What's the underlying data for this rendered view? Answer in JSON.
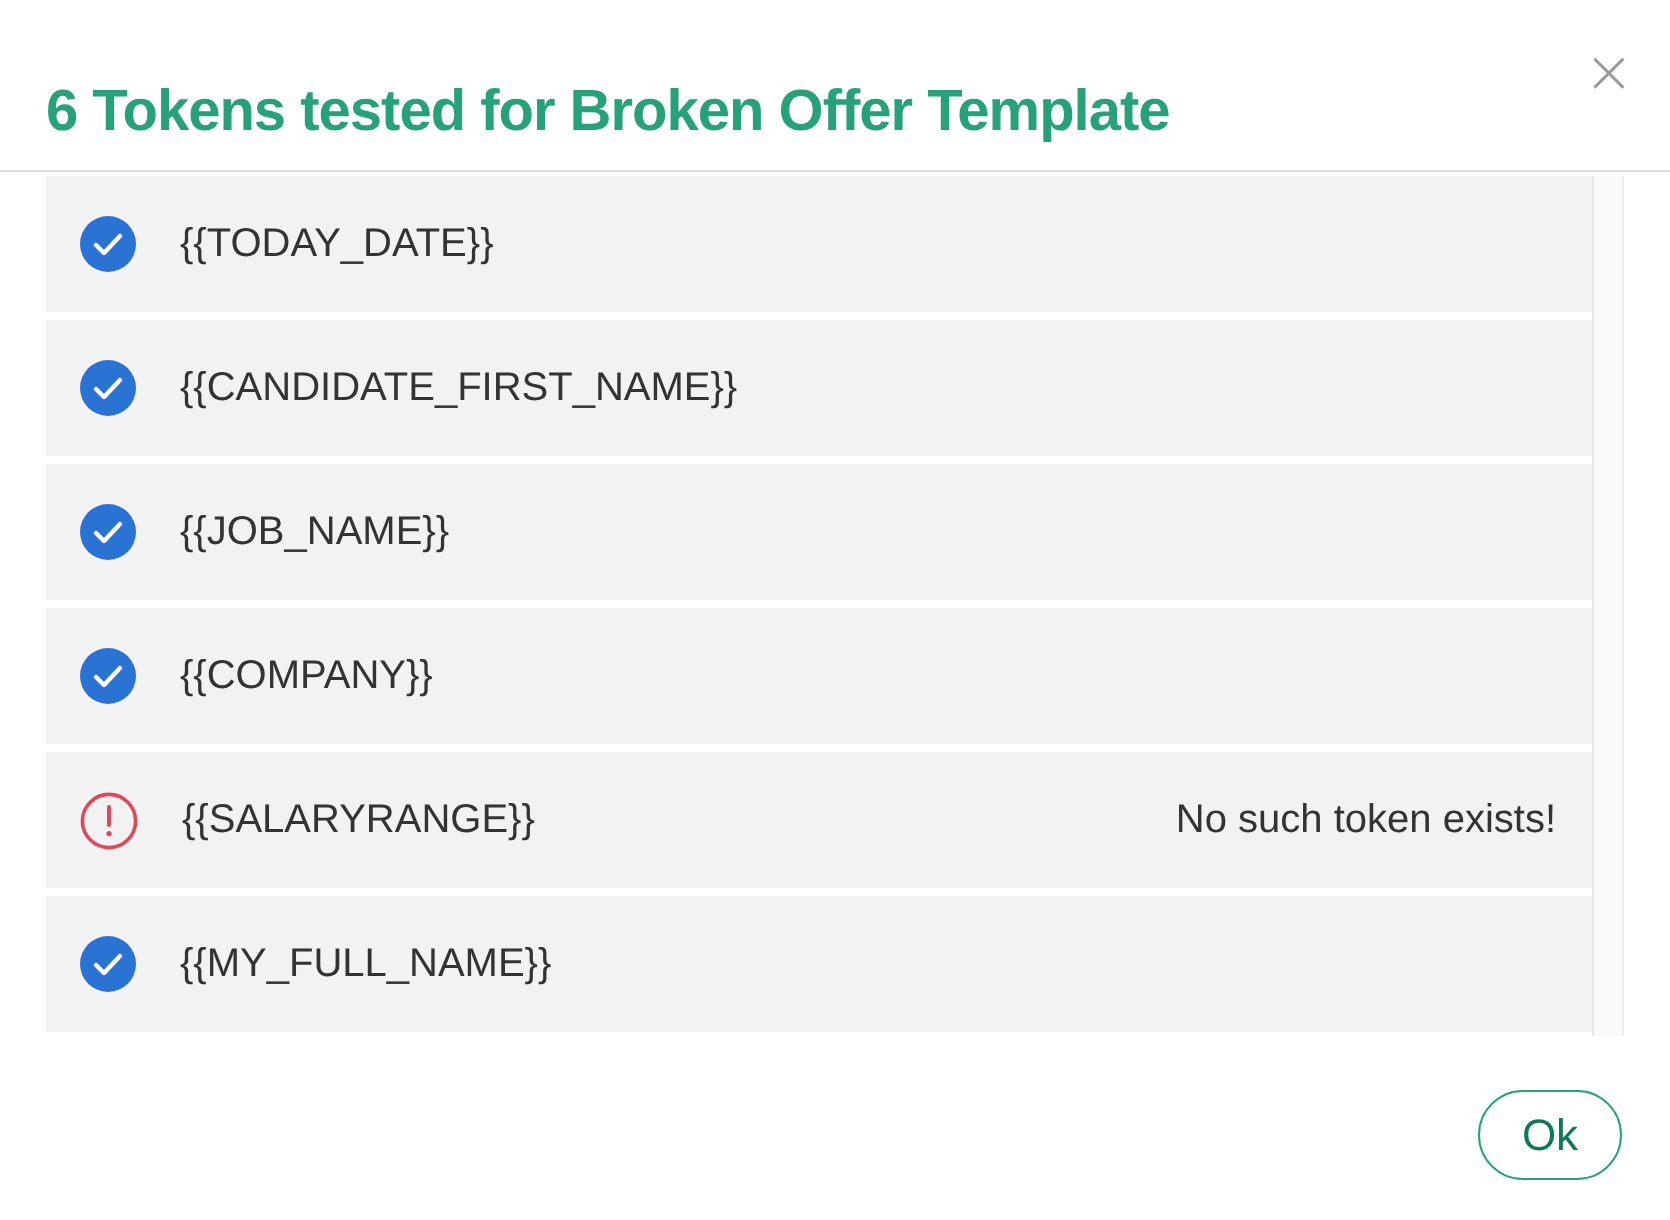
{
  "dialog": {
    "title": "6 Tokens tested for Broken Offer Template",
    "close_button": "×"
  },
  "tokens": [
    {
      "token": "{{TODAY_DATE}}",
      "kind": "valid"
    },
    {
      "token": "{{CANDIDATE_FIRST_NAME}}",
      "kind": "valid"
    },
    {
      "token": "{{JOB_NAME}}",
      "kind": "valid"
    },
    {
      "token": "{{COMPANY}}",
      "kind": "valid"
    },
    {
      "token": "{{SALARYRANGE}}",
      "kind": "invalid",
      "message": "No such token exists!"
    },
    {
      "token": "{{MY_FULL_NAME}}",
      "kind": "valid"
    }
  ],
  "buttons": [
    {
      "label": "Ok"
    }
  ]
}
